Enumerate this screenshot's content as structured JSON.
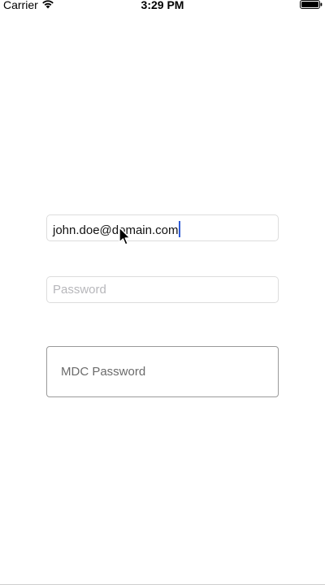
{
  "status_bar": {
    "carrier": "Carrier",
    "time": "3:29 PM",
    "wifi_icon": "wifi-icon",
    "battery_icon": "battery-full-icon"
  },
  "form": {
    "email": {
      "value": "john.doe@domain.com",
      "focused": true
    },
    "password": {
      "placeholder": "Password",
      "value": ""
    },
    "mdc_password": {
      "label": "MDC Password",
      "value": ""
    }
  },
  "pointer": {
    "icon": "mouse-pointer-icon"
  },
  "colors": {
    "caret": "#2f5bd6",
    "field_border": "#dcdcdc",
    "mdc_border": "#9a9a9a",
    "placeholder": "#b7b7bb"
  }
}
